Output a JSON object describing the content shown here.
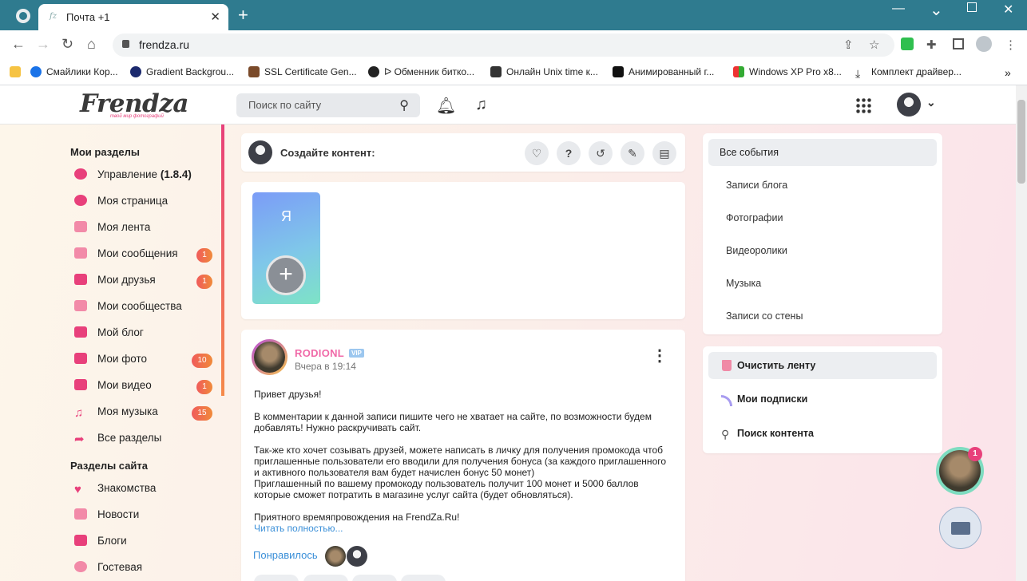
{
  "browser": {
    "tab_title": "Почта +1",
    "tab_favicon": "fz",
    "url": "frendza.ru",
    "new_tab": "+",
    "bookmarks": [
      "Смайлики Кор...",
      "Gradient Backgrou...",
      "SSL Certificate Gen...",
      "ᐅ Обменник битко...",
      "Онлайн Unix time к...",
      "Анимированный г...",
      "Windows XP Pro x8...",
      "Комплект драйвер..."
    ]
  },
  "site": {
    "logo": "Frendza",
    "logo_tagline": "твой мир фотографий",
    "search_placeholder": "Поиск по сайту"
  },
  "sidebar": {
    "my_sections_title": "Мои разделы",
    "items": [
      {
        "label": "Управление",
        "extra": "(1.8.4)",
        "badge": ""
      },
      {
        "label": "Моя страница",
        "extra": "",
        "badge": ""
      },
      {
        "label": "Моя лента",
        "extra": "",
        "badge": ""
      },
      {
        "label": "Мои сообщения",
        "extra": "",
        "badge": "1"
      },
      {
        "label": "Мои друзья",
        "extra": "",
        "badge": "1"
      },
      {
        "label": "Мои сообщества",
        "extra": "",
        "badge": ""
      },
      {
        "label": "Мой блог",
        "extra": "",
        "badge": ""
      },
      {
        "label": "Мои фото",
        "extra": "",
        "badge": "10"
      },
      {
        "label": "Мои видео",
        "extra": "",
        "badge": "1"
      },
      {
        "label": "Моя музыка",
        "extra": "",
        "badge": "15"
      },
      {
        "label": "Все разделы",
        "extra": "",
        "badge": ""
      }
    ],
    "site_sections_title": "Разделы сайта",
    "site_items": [
      "Знакомства",
      "Новости",
      "Блоги",
      "Гостевая"
    ]
  },
  "create": {
    "label": "Создайте контент:"
  },
  "stories": {
    "letter": "Я",
    "add": "+"
  },
  "post": {
    "author": "RODIONL",
    "badge": "VIP",
    "time": "Вчера в 19:14",
    "p1": "Привет друзья!",
    "p2": "В комментарии к данной записи пишите чего не хватает на сайте, по возможности будем добавлять! Нужно раскручивать сайт.",
    "p3": "Так-же кто хочет созывать друзей, можете написать в личку для получения промокода чтоб приглашенные пользователи его вводили для получения бонуса (за каждого приглашенного и активного пользователя вам будет начислен бонус 50 монет)",
    "p4": "Приглашенный по вашему промокоду пользователь получит 100 монет и 5000 баллов которые сможет потратить в магазине услуг сайта (будет обновляться).",
    "p5": "Приятного времяпровождения на FrendZa.Ru!",
    "read_more": "Читать полностью...",
    "liked": "Понравилось"
  },
  "filters": {
    "active": "Все события",
    "items": [
      "Записи блога",
      "Фотографии",
      "Видеоролики",
      "Музыка",
      "Записи со стены"
    ]
  },
  "feed_actions": {
    "clear": "Очистить ленту",
    "subs": "Мои подписки",
    "search": "Поиск контента"
  },
  "floating": {
    "notif_count": "1"
  },
  "colors": {
    "accent": "#e8407b",
    "link": "#3a8fd8",
    "titlebar": "#2f7b8f"
  }
}
